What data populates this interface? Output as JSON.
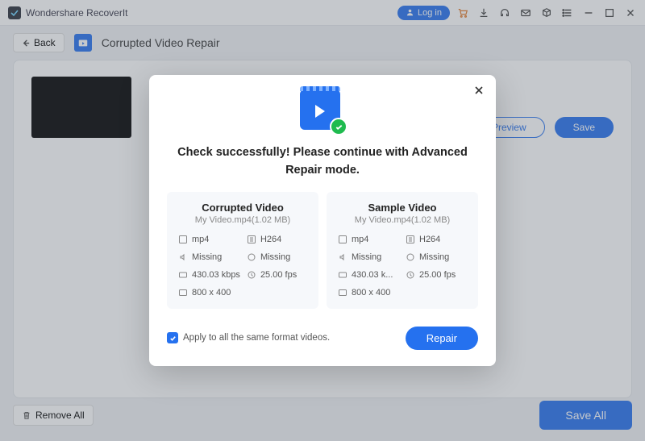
{
  "app": {
    "name": "Wondershare RecoverIt"
  },
  "titlebar": {
    "login": "Log in"
  },
  "header": {
    "back": "Back",
    "module": "Corrupted Video Repair"
  },
  "card": {
    "actions": {
      "preview": "Preview",
      "save": "Save"
    }
  },
  "footer": {
    "removeAll": "Remove All",
    "saveAll": "Save All"
  },
  "modal": {
    "message": "Check successfully! Please continue with Advanced Repair mode.",
    "corrupted": {
      "title": "Corrupted Video",
      "subtitle": "My Video.mp4(1.02  MB)",
      "specs": {
        "format": "mp4",
        "codec": "H264",
        "audio": "Missing",
        "aformat": "Missing",
        "bitrate": "430.03 kbps",
        "fps": "25.00 fps",
        "res": "800 x 400"
      }
    },
    "sample": {
      "title": "Sample Video",
      "subtitle": "My Video.mp4(1.02  MB)",
      "specs": {
        "format": "mp4",
        "codec": "H264",
        "audio": "Missing",
        "aformat": "Missing",
        "bitrate": "430.03 k...",
        "fps": "25.00 fps",
        "res": "800 x 400"
      }
    },
    "applyAll": "Apply to all the same format videos.",
    "repair": "Repair"
  }
}
